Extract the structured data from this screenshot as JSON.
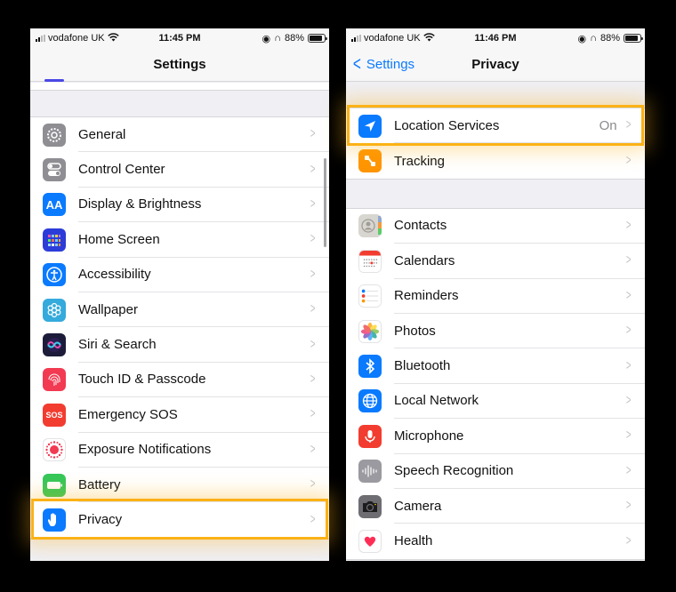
{
  "left_screen": {
    "status_bar": {
      "carrier": "vodafone UK",
      "time": "11:45 PM",
      "battery": "88%",
      "battery_level": 0.88
    },
    "nav": {
      "title": "Settings"
    },
    "items": [
      {
        "label": "General",
        "icon": "gear-icon",
        "color": "#8e8e93"
      },
      {
        "label": "Control Center",
        "icon": "toggles-icon",
        "color": "#8e8e93"
      },
      {
        "label": "Display & Brightness",
        "icon": "text-size-icon",
        "color": "#0a7aff",
        "glyph": "AA"
      },
      {
        "label": "Home Screen",
        "icon": "app-grid-icon",
        "color": "#2c3cd8"
      },
      {
        "label": "Accessibility",
        "icon": "accessibility-icon",
        "color": "#0a7aff"
      },
      {
        "label": "Wallpaper",
        "icon": "flower-icon",
        "color": "#35aadc"
      },
      {
        "label": "Siri & Search",
        "icon": "siri-icon",
        "color": "#1c1c3a"
      },
      {
        "label": "Touch ID & Passcode",
        "icon": "fingerprint-icon",
        "color": "#f23a52"
      },
      {
        "label": "Emergency SOS",
        "icon": "sos-icon",
        "color": "#f23c30",
        "glyph": "SOS"
      },
      {
        "label": "Exposure Notifications",
        "icon": "exposure-icon",
        "color": "#ffffff"
      },
      {
        "label": "Battery",
        "icon": "battery-icon",
        "color": "#34c759"
      },
      {
        "label": "Privacy",
        "icon": "hand-icon",
        "color": "#0a7aff",
        "highlighted": true
      }
    ]
  },
  "right_screen": {
    "status_bar": {
      "carrier": "vodafone UK",
      "time": "11:46 PM",
      "battery": "88%",
      "battery_level": 0.88
    },
    "nav": {
      "back_label": "Settings",
      "title": "Privacy"
    },
    "group1": [
      {
        "label": "Location Services",
        "value": "On",
        "icon": "location-arrow-icon",
        "color": "#0a7aff",
        "highlighted": true
      },
      {
        "label": "Tracking",
        "icon": "tracking-icon",
        "color": "#ff9500"
      }
    ],
    "group2": [
      {
        "label": "Contacts",
        "icon": "contacts-icon",
        "color": "#d8d6d0"
      },
      {
        "label": "Calendars",
        "icon": "calendar-icon",
        "color": "#ffffff"
      },
      {
        "label": "Reminders",
        "icon": "reminders-icon",
        "color": "#ffffff"
      },
      {
        "label": "Photos",
        "icon": "photos-icon",
        "color": "#ffffff"
      },
      {
        "label": "Bluetooth",
        "icon": "bluetooth-icon",
        "color": "#0a7aff"
      },
      {
        "label": "Local Network",
        "icon": "globe-icon",
        "color": "#0a7aff"
      },
      {
        "label": "Microphone",
        "icon": "microphone-icon",
        "color": "#f23c30"
      },
      {
        "label": "Speech Recognition",
        "icon": "waveform-icon",
        "color": "#9a9aa0"
      },
      {
        "label": "Camera",
        "icon": "camera-icon",
        "color": "#6d6d72"
      },
      {
        "label": "Health",
        "icon": "heart-icon",
        "color": "#ffffff"
      }
    ]
  },
  "accent": {
    "highlight": "#fbb216",
    "link": "#0a7aff"
  }
}
